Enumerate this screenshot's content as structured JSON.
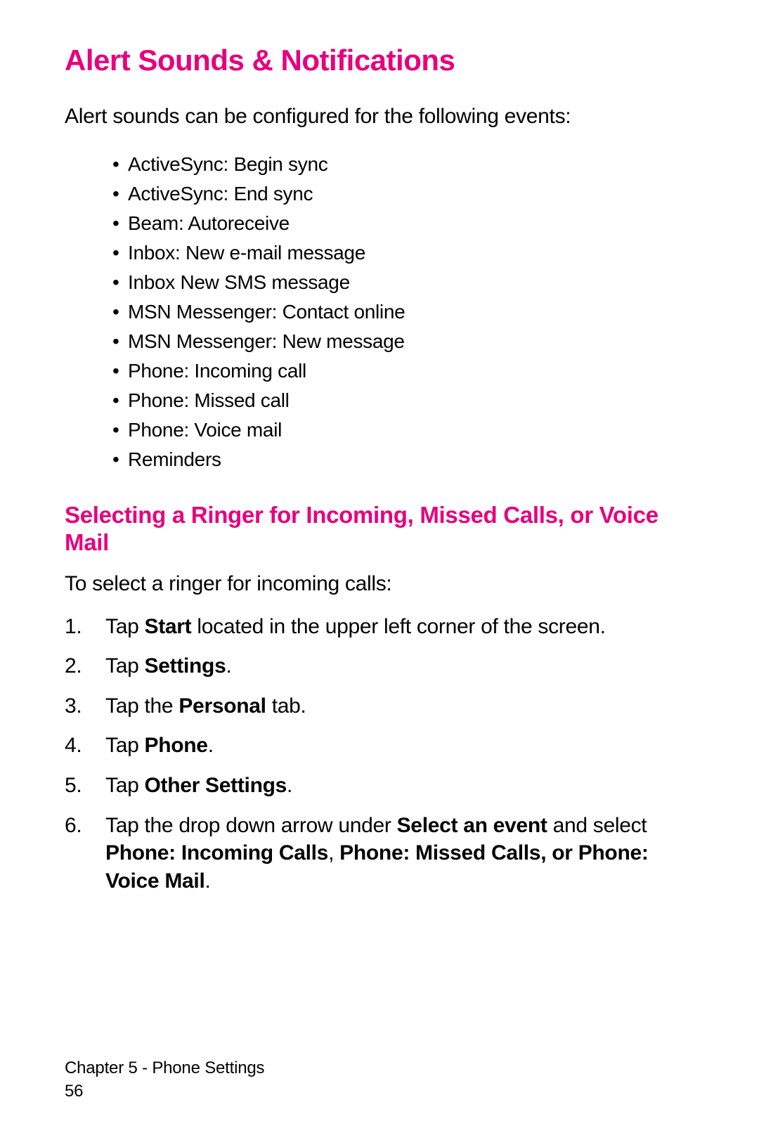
{
  "title": "Alert Sounds & Notifications",
  "intro": "Alert sounds can be configured for the following events:",
  "bullets": [
    "ActiveSync: Begin sync",
    "ActiveSync: End sync",
    "Beam: Autoreceive",
    "Inbox: New e-mail message",
    "Inbox New SMS message",
    "MSN Messenger: Contact online",
    "MSN Messenger: New message",
    "Phone: Incoming call",
    "Phone: Missed call",
    "Phone: Voice mail",
    "Reminders"
  ],
  "subtitle": "Selecting a Ringer for Incoming, Missed Calls, or Voice Mail",
  "subintro": "To select a ringer for incoming calls:",
  "steps": [
    {
      "text": "Tap ",
      "bold": "Start",
      "after": " located in the upper left corner of the screen."
    },
    {
      "text": "Tap ",
      "bold": "Settings",
      "after": "."
    },
    {
      "text": "Tap the ",
      "bold": "Personal",
      "after": " tab."
    },
    {
      "text": "Tap ",
      "bold": "Phone",
      "after": "."
    },
    {
      "text": "Tap ",
      "bold": "Other Settings",
      "after": "."
    },
    {
      "text": "Tap the drop down arrow under ",
      "bold": "Select an event",
      "after": " and select ",
      "bold2": "Phone: Incoming Calls",
      "after2": ", ",
      "bold3": "Phone: Missed Calls, or Phone: Voice Mail",
      "after3": "."
    }
  ],
  "footer_chapter": "Chapter 5 - Phone Settings",
  "footer_page": "56"
}
